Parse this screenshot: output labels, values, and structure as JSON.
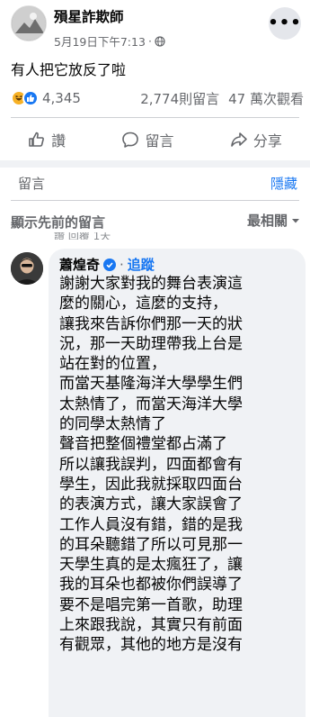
{
  "post": {
    "author": "殞星詐欺師",
    "date": "5月19日下午7:13",
    "visibility_icon": "globe-icon",
    "more_icon": "more-options-icon",
    "more_label": "•••",
    "text": "有人把它放反了啦"
  },
  "stats": {
    "reaction_icons": [
      "haha-reaction-icon",
      "like-reaction-icon"
    ],
    "reaction_count": "4,345",
    "comment_count": "2,774則留言",
    "view_count": "47 萬次觀看"
  },
  "actions": [
    {
      "label": "讚",
      "icon": "thumbs-up-icon"
    },
    {
      "label": "留言",
      "icon": "comment-icon"
    },
    {
      "label": "分享",
      "icon": "share-icon"
    }
  ],
  "comment_box": {
    "placeholder": "留言",
    "hide_label": "隱藏"
  },
  "comments_section": {
    "previous_label": "顯示先前的留言",
    "sort_label": "最相關",
    "cut_off_text": "讚   回覆   1天"
  },
  "comment": {
    "name": "蕭煌奇",
    "verified_icon": "verified-badge-icon",
    "separator": "·",
    "follow_label": "追蹤",
    "lines": [
      "謝謝大家對我的舞台表演這",
      "麼的關心，這麼的支持，",
      "讓我來告訴你們那一天的狀",
      "況，那一天助理帶我上台是",
      "站在對的位置，",
      "而當天基隆海洋大學學生們",
      "太熱情了，而當天海洋大學",
      "的同學太熱情了",
      "聲音把整個禮堂都占滿了",
      "所以讓我誤判，四面都會有",
      "學生，因此我就採取四面台",
      "的表演方式，讓大家誤會了",
      "工作人員沒有錯，錯的是我",
      "的耳朵聽錯了所以可見那一",
      "天學生真的是太瘋狂了，讓",
      "我的耳朵也都被你們誤導了",
      "要不是唱完第一首歌，助理",
      "上來跟我說，其實只有前面",
      "有觀眾，其他的地方是沒有"
    ]
  },
  "colors": {
    "accent": "#1877f2",
    "secondary_text": "#65676b",
    "bubble_bg": "#f0f2f5"
  }
}
